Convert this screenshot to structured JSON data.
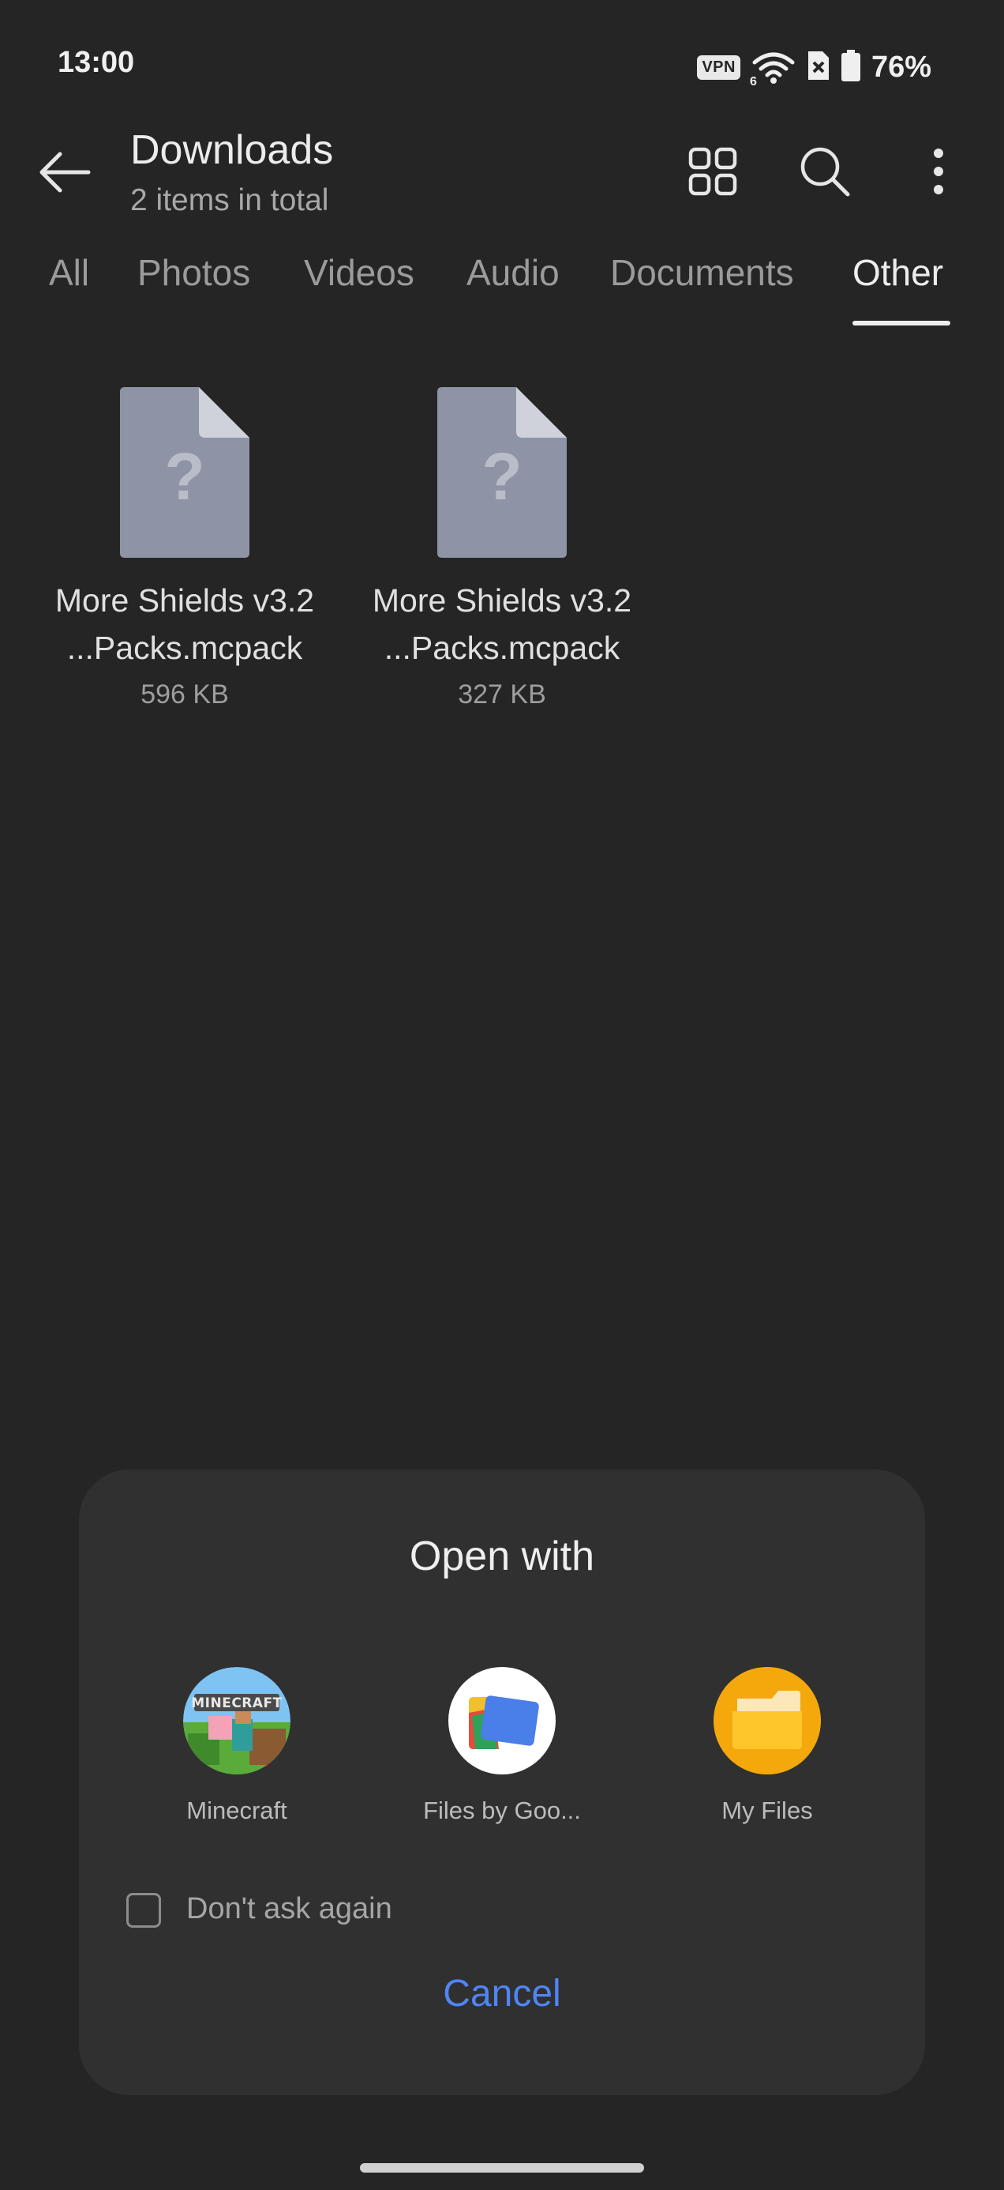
{
  "status_bar": {
    "time": "13:00",
    "vpn": "VPN",
    "network": "6",
    "battery": "76%"
  },
  "header": {
    "title": "Downloads",
    "subtitle": "2 items in total"
  },
  "tabs": [
    {
      "label": "All"
    },
    {
      "label": "Photos"
    },
    {
      "label": "Videos"
    },
    {
      "label": "Audio"
    },
    {
      "label": "Documents"
    },
    {
      "label": "Other",
      "active": true
    }
  ],
  "files": [
    {
      "name_line1": "More Shields v3.2",
      "name_line2": "...Packs.mcpack",
      "size": "596 KB"
    },
    {
      "name_line1": "More Shields v3.2",
      "name_line2": "...Packs.mcpack",
      "size": "327 KB"
    }
  ],
  "dialog": {
    "title": "Open with",
    "apps": [
      {
        "label": "Minecraft",
        "icon": "minecraft-icon"
      },
      {
        "label": "Files by Goo...",
        "icon": "files-by-google-icon"
      },
      {
        "label": "My Files",
        "icon": "my-files-icon"
      }
    ],
    "dont_ask_label": "Don't ask again",
    "cancel_label": "Cancel"
  },
  "colors": {
    "background": "#252525",
    "dialog": "#303030",
    "accent": "#4f85f7"
  }
}
